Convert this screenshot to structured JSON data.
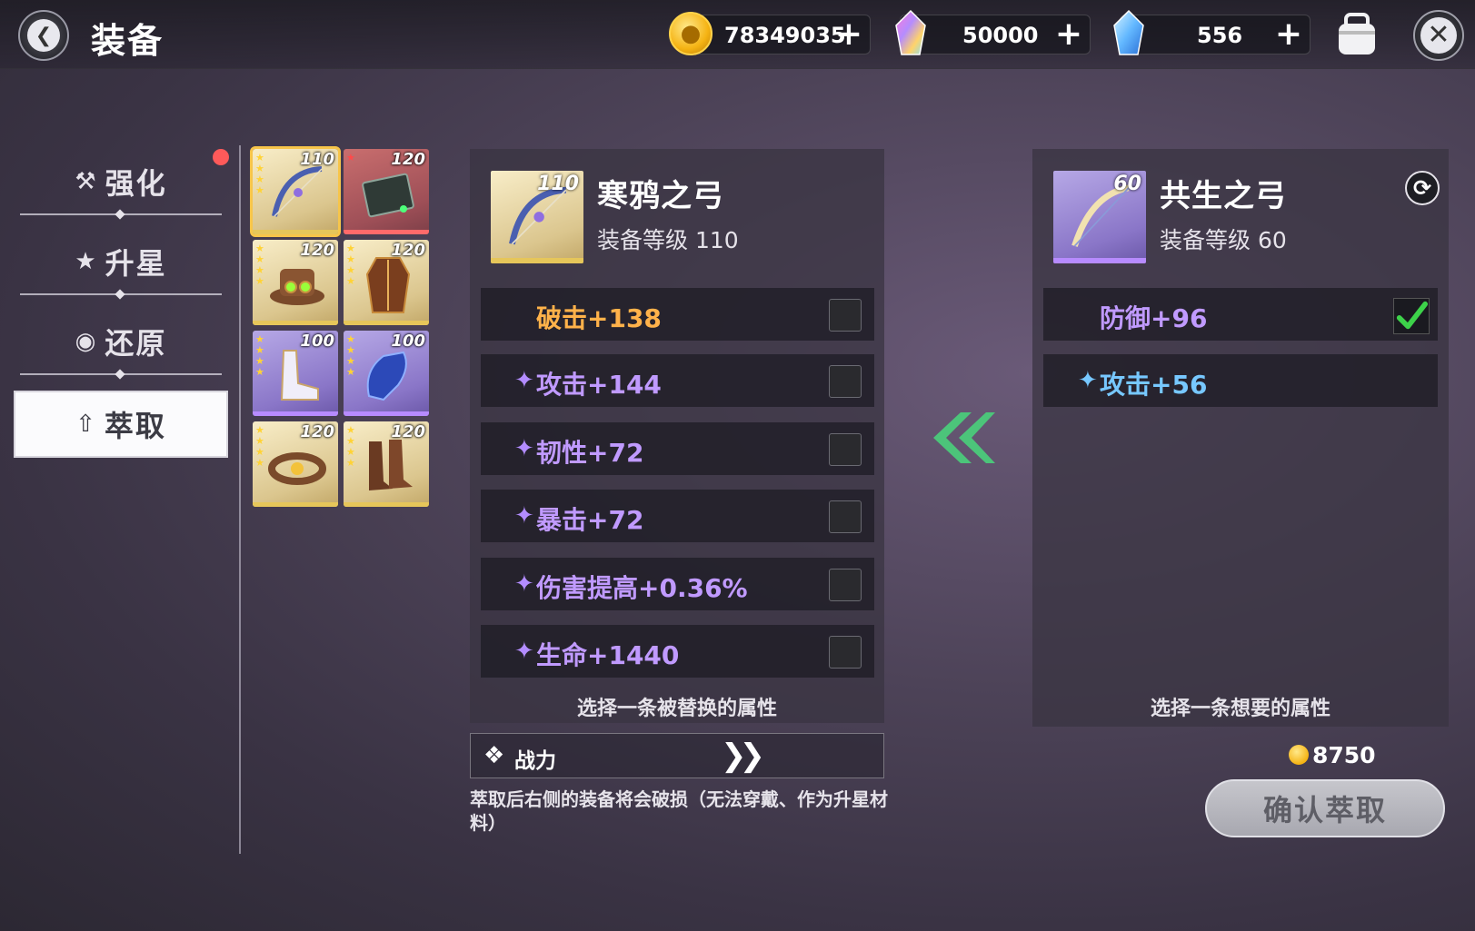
{
  "header": {
    "title": "装备"
  },
  "currencies": [
    {
      "name": "gold",
      "value": "78349035"
    },
    {
      "name": "rainbow-crystal",
      "value": "50000"
    },
    {
      "name": "blue-crystal",
      "value": "556"
    }
  ],
  "side_menu": [
    {
      "label": "强化",
      "icon": "hammer-icon"
    },
    {
      "label": "升星",
      "icon": "star-up-icon"
    },
    {
      "label": "还原",
      "icon": "restore-icon"
    },
    {
      "label": "萃取",
      "icon": "extract-icon",
      "active": true
    }
  ],
  "equipment_grid": [
    {
      "level": "110",
      "rarity": "gold",
      "selected": true,
      "item": "bow"
    },
    {
      "level": "120",
      "rarity": "red",
      "item": "book"
    },
    {
      "level": "120",
      "rarity": "gold",
      "item": "hat"
    },
    {
      "level": "120",
      "rarity": "gold",
      "item": "coat"
    },
    {
      "level": "100",
      "rarity": "purple",
      "item": "boots-white"
    },
    {
      "level": "100",
      "rarity": "purple",
      "item": "gloves"
    },
    {
      "level": "120",
      "rarity": "gold",
      "item": "belt"
    },
    {
      "level": "120",
      "rarity": "gold",
      "item": "boots"
    }
  ],
  "left_item": {
    "name": "寒鸦之弓",
    "level_label": "装备等级 110",
    "thumb_level": "110",
    "attributes": [
      {
        "text": "破击+138",
        "color": "orange",
        "main": true
      },
      {
        "text": "攻击+144",
        "color": "purple"
      },
      {
        "text": "韧性+72",
        "color": "purple"
      },
      {
        "text": "暴击+72",
        "color": "purple"
      },
      {
        "text": "伤害提高+0.36%",
        "color": "purple"
      },
      {
        "text": "生命+1440",
        "color": "purple"
      }
    ],
    "hint": "选择一条被替换的属性"
  },
  "right_item": {
    "name": "共生之弓",
    "level_label": "装备等级 60",
    "thumb_level": "60",
    "attributes": [
      {
        "text": "防御+96",
        "color": "purple",
        "checked": true
      },
      {
        "text": "攻击+56",
        "color": "blue"
      }
    ],
    "hint": "选择一条想要的属性"
  },
  "power": {
    "label": "战力"
  },
  "note": "萃取后右侧的装备将会破损（无法穿戴、作为升星材料）",
  "cost": "8750",
  "confirm_label": "确认萃取"
}
